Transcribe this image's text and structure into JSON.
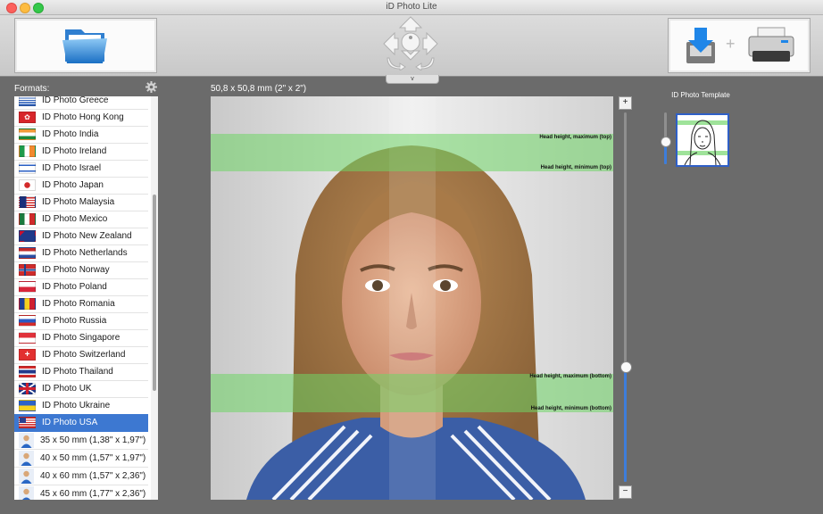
{
  "window": {
    "title": "iD Photo Lite"
  },
  "toolbar": {
    "nav_toggle_label": "v"
  },
  "formats": {
    "label": "Formats:",
    "items": [
      {
        "label": "ID Photo Greece",
        "icon": "greece-flag-icon"
      },
      {
        "label": "ID Photo Hong Kong",
        "icon": "hong-kong-flag-icon"
      },
      {
        "label": "ID Photo India",
        "icon": "india-flag-icon"
      },
      {
        "label": "ID Photo Ireland",
        "icon": "ireland-flag-icon"
      },
      {
        "label": "ID Photo Israel",
        "icon": "israel-flag-icon"
      },
      {
        "label": "ID Photo Japan",
        "icon": "japan-flag-icon"
      },
      {
        "label": "ID Photo Malaysia",
        "icon": "malaysia-flag-icon"
      },
      {
        "label": "ID Photo Mexico",
        "icon": "mexico-flag-icon"
      },
      {
        "label": "ID Photo New Zealand",
        "icon": "new-zealand-flag-icon"
      },
      {
        "label": "ID Photo Netherlands",
        "icon": "netherlands-flag-icon"
      },
      {
        "label": "ID Photo Norway",
        "icon": "norway-flag-icon"
      },
      {
        "label": "ID Photo Poland",
        "icon": "poland-flag-icon"
      },
      {
        "label": "ID Photo Romania",
        "icon": "romania-flag-icon"
      },
      {
        "label": "ID Photo Russia",
        "icon": "russia-flag-icon"
      },
      {
        "label": "ID Photo Singapore",
        "icon": "singapore-flag-icon"
      },
      {
        "label": "ID Photo Switzerland",
        "icon": "switzerland-flag-icon"
      },
      {
        "label": "ID Photo Thailand",
        "icon": "thailand-flag-icon"
      },
      {
        "label": "ID Photo UK",
        "icon": "uk-flag-icon"
      },
      {
        "label": "ID Photo Ukraine",
        "icon": "ukraine-flag-icon"
      },
      {
        "label": "ID Photo USA",
        "icon": "usa-flag-icon",
        "selected": true
      },
      {
        "label": "35 x 50 mm (1,38\" x 1,97\")",
        "icon": "person-icon"
      },
      {
        "label": "40 x 50 mm (1,57\" x 1,97\")",
        "icon": "person-icon"
      },
      {
        "label": "40 x 60 mm (1,57\" x 2,36\")",
        "icon": "person-icon"
      },
      {
        "label": "45 x 60 mm (1,77\" x 2,36\")",
        "icon": "person-icon"
      }
    ]
  },
  "canvas": {
    "dimension_label": "50,8 x 50,8 mm (2\" x 2\")",
    "guides": {
      "head_max_top": "Head height, maximum (top)",
      "head_min_top": "Head height, minimum (top)",
      "head_max_bottom": "Head height, maximum (bottom)",
      "head_min_bottom": "Head height, minimum (bottom)"
    }
  },
  "zoom": {
    "plus_label": "+",
    "minus_label": "−",
    "level": 0.31
  },
  "template": {
    "label": "ID Photo Template",
    "size_level": 0.45
  },
  "colors": {
    "accent": "#3d78d1",
    "guide": "#70d666"
  }
}
